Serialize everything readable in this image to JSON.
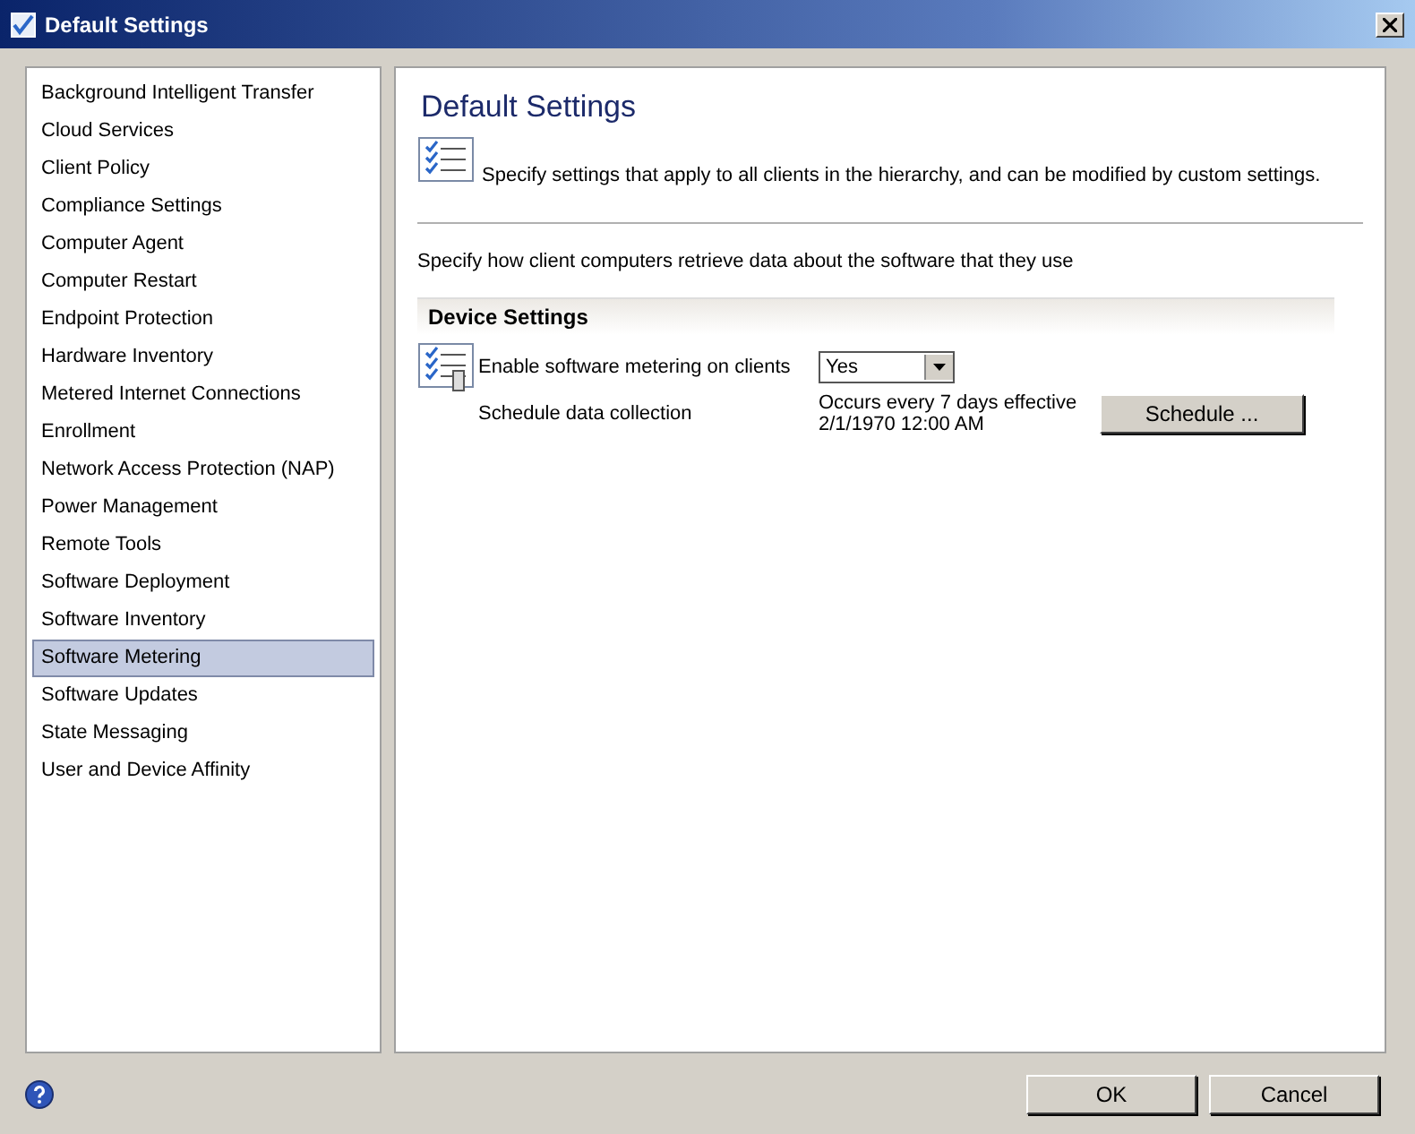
{
  "window": {
    "title": "Default Settings"
  },
  "sidebar": {
    "items": [
      {
        "label": "Background Intelligent Transfer",
        "selected": false
      },
      {
        "label": "Cloud Services",
        "selected": false
      },
      {
        "label": "Client Policy",
        "selected": false
      },
      {
        "label": "Compliance Settings",
        "selected": false
      },
      {
        "label": "Computer Agent",
        "selected": false
      },
      {
        "label": "Computer Restart",
        "selected": false
      },
      {
        "label": "Endpoint Protection",
        "selected": false
      },
      {
        "label": "Hardware Inventory",
        "selected": false
      },
      {
        "label": "Metered Internet Connections",
        "selected": false
      },
      {
        "label": "Enrollment",
        "selected": false
      },
      {
        "label": "Network Access Protection (NAP)",
        "selected": false
      },
      {
        "label": "Power Management",
        "selected": false
      },
      {
        "label": "Remote Tools",
        "selected": false
      },
      {
        "label": "Software Deployment",
        "selected": false
      },
      {
        "label": "Software Inventory",
        "selected": false
      },
      {
        "label": "Software Metering",
        "selected": true
      },
      {
        "label": "Software Updates",
        "selected": false
      },
      {
        "label": "State Messaging",
        "selected": false
      },
      {
        "label": "User and Device Affinity",
        "selected": false
      }
    ]
  },
  "content": {
    "heading": "Default Settings",
    "description": "Specify settings that apply to all clients in the hierarchy, and can be modified by custom settings.",
    "intro": "Specify how client computers retrieve data about the software that they use",
    "section": {
      "title": "Device Settings",
      "enable_label": "Enable software metering on clients",
      "enable_value": "Yes",
      "schedule_label": "Schedule data collection",
      "schedule_text": [
        "Occurs every 7 days effective",
        "2/1/1970 12:00 AM"
      ],
      "schedule_button": "Schedule ..."
    }
  },
  "buttons": [
    "OK",
    "Cancel"
  ]
}
